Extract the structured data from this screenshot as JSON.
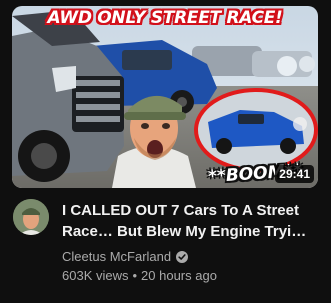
{
  "thumbnail": {
    "overlay_title": "AWD ONLY STREET RACE!",
    "callout_text": "**BOOM**",
    "duration": "29:41"
  },
  "video": {
    "title_line1": "I CALLED OUT 7 Cars To A Street",
    "title_line2": "Race… But Blew My Engine Tryi…"
  },
  "channel": {
    "name": "Cleetus McFarland",
    "verified_icon": "check-circle-icon"
  },
  "meta": {
    "views": "603K views",
    "separator": "•",
    "age": "20 hours ago"
  },
  "colors": {
    "background": "#0f0f0f",
    "title_text": "#f1f1f1",
    "secondary_text": "#aaaaaa",
    "thumb_title_outline": "#d2101a",
    "circle_highlight": "#e11b1b"
  }
}
